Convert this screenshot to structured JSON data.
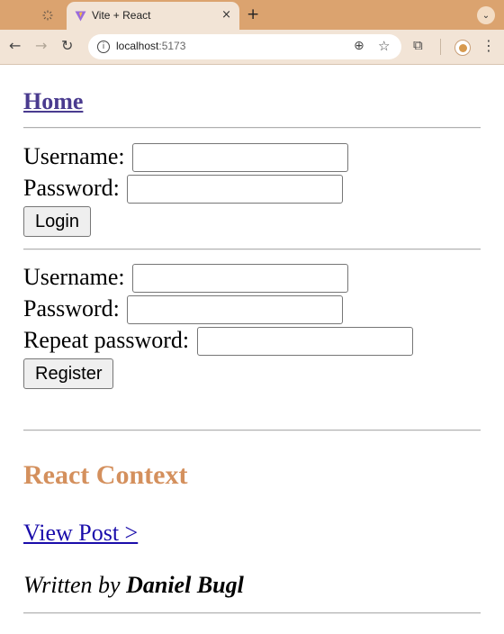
{
  "browser": {
    "tab_title": "Vite + React",
    "tab_close": "×",
    "new_tab": "+",
    "tab_menu": "⌄",
    "url_host": "localhost",
    "url_port": ":5173",
    "icons": [
      "back-arrow-icon",
      "forward-arrow-icon",
      "reload-icon",
      "site-info-icon",
      "zoom-icon",
      "bookmark-star-icon",
      "extensions-icon",
      "profile-icon",
      "menu-icon"
    ]
  },
  "page": {
    "home_link": "Home",
    "login": {
      "username_label": "Username:",
      "password_label": "Password:",
      "username_value": "",
      "password_value": "",
      "submit_label": "Login"
    },
    "register": {
      "username_label": "Username:",
      "password_label": "Password:",
      "repeat_label": "Repeat password:",
      "username_value": "",
      "password_value": "",
      "repeat_value": "",
      "submit_label": "Register"
    },
    "post": {
      "title": "React Context",
      "view_link": "View Post >",
      "byline_prefix": "Written by ",
      "author": "Daniel Bugl"
    },
    "colors": {
      "title_color": "#d4905d",
      "link_color": "#1a0dab",
      "home_link_color": "#4a3b8f",
      "chrome_tabbar": "#dba36f"
    }
  }
}
